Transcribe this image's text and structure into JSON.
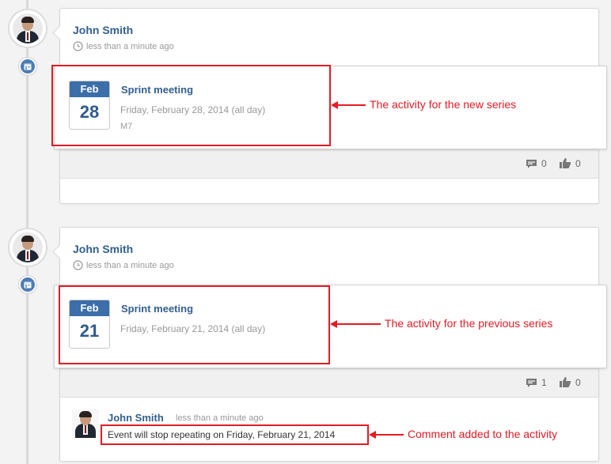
{
  "activities": [
    {
      "author": "John Smith",
      "time": "less than a minute ago",
      "event": {
        "month": "Feb",
        "day": "28",
        "title": "Sprint meeting",
        "date_text": "Friday, February 28, 2014 (all day)",
        "location": "M7"
      },
      "comments_count": "0",
      "likes_count": "0",
      "annotation": "The activity for the new series"
    },
    {
      "author": "John Smith",
      "time": "less than a minute ago",
      "event": {
        "month": "Feb",
        "day": "21",
        "title": "Sprint meeting",
        "date_text": "Friday, February 21, 2014 (all day)"
      },
      "comments_count": "1",
      "likes_count": "0",
      "annotation": "The activity for the previous series",
      "comment": {
        "author": "John Smith",
        "time": "less than a minute ago",
        "text": "Event will stop repeating on Friday, February 21, 2014",
        "annotation": "Comment added to the activity"
      }
    }
  ],
  "colors": {
    "link": "#335f8e",
    "calendar_header": "#3c6ea9",
    "annotation": "#e31b23",
    "badge": "#4d7db5"
  },
  "icons": [
    "clock-icon",
    "calendar-icon",
    "comment-icon",
    "like-icon"
  ]
}
